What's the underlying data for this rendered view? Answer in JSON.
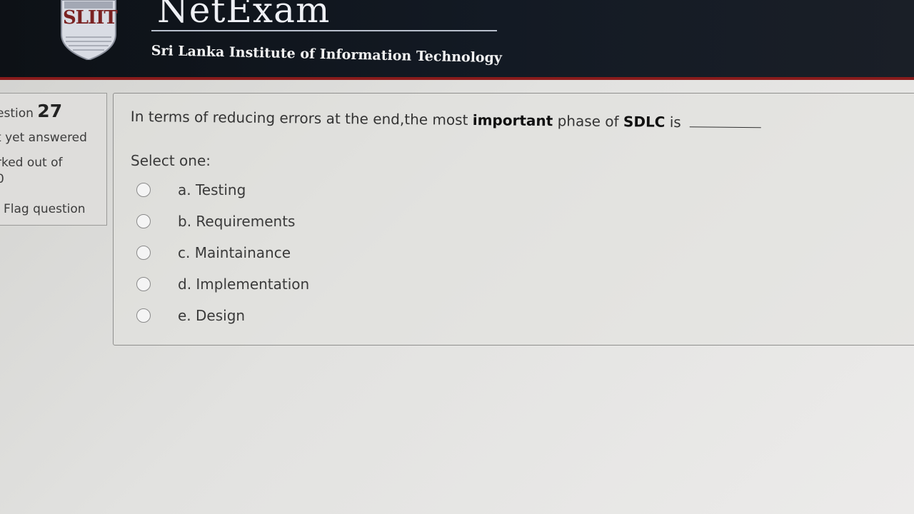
{
  "header": {
    "logo_text": "SLIIT",
    "app_title": "NetExam",
    "institute": "Sri Lanka Institute of Information Technology"
  },
  "info": {
    "question_label": "estion",
    "question_number": "27",
    "state": "t yet answered",
    "marked_label": "rked out of",
    "marked_value": "0",
    "flag_label": "Flag question"
  },
  "question": {
    "text_part1": "In terms of reducing errors at the end,the most",
    "bold1": "important",
    "text_part2": "phase of",
    "bold2": "SDLC",
    "text_part3": "is",
    "select_label": "Select one:",
    "options": [
      {
        "label": "a. Testing"
      },
      {
        "label": "b. Requirements"
      },
      {
        "label": "c. Maintainance"
      },
      {
        "label": "d. Implementation"
      },
      {
        "label": "e. Design"
      }
    ]
  }
}
